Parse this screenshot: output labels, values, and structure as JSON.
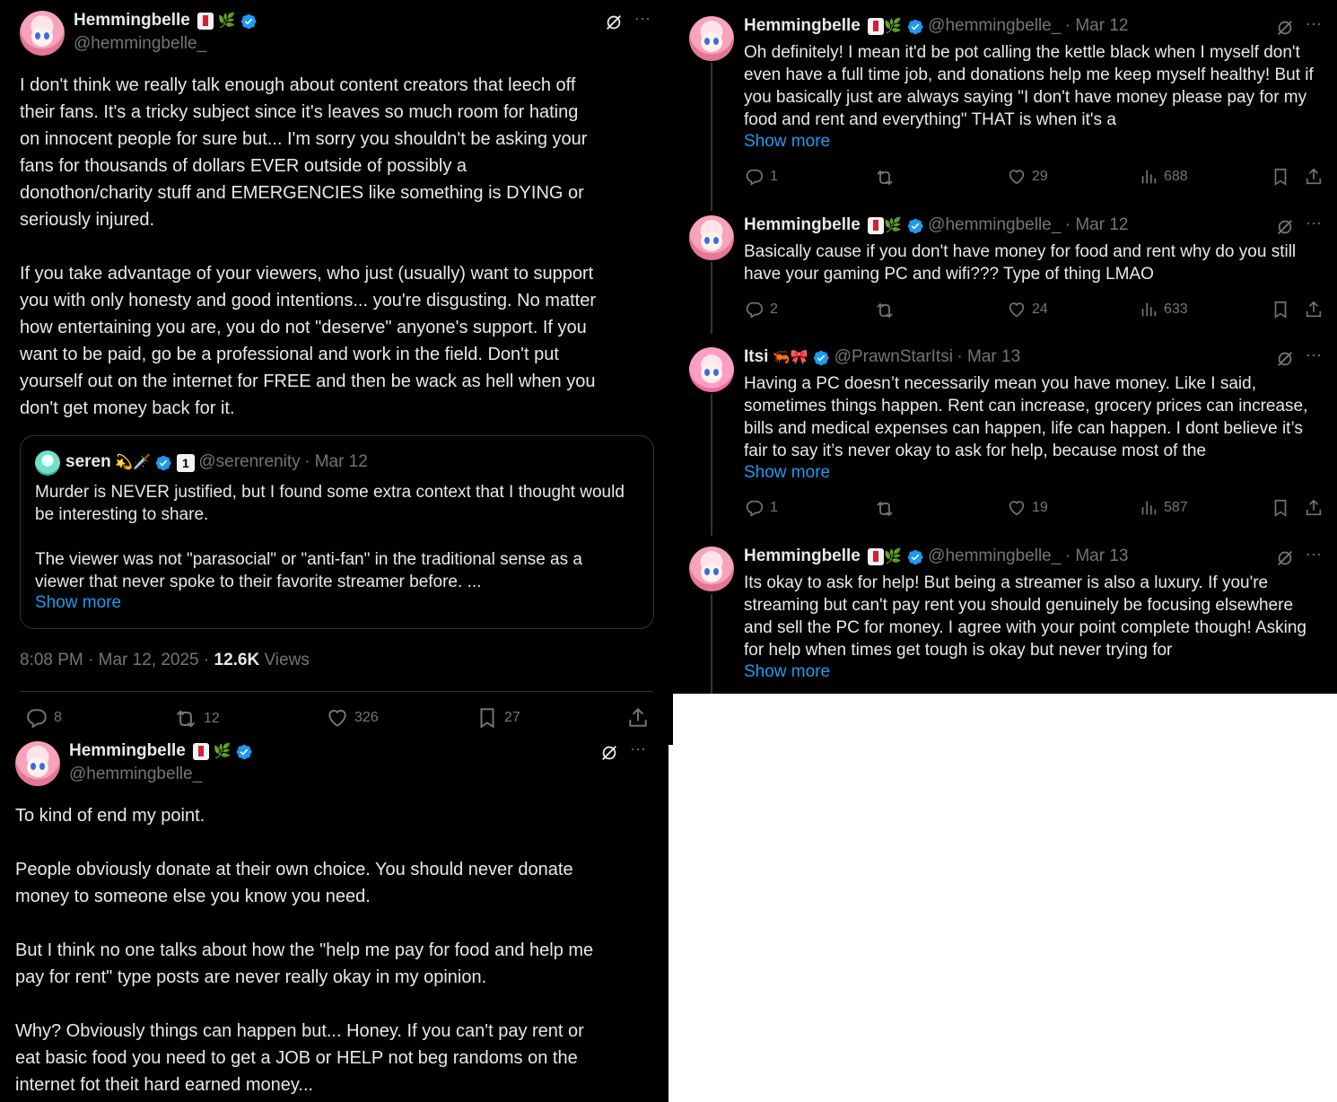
{
  "main_post": {
    "display_name": "Hemmingbelle",
    "handle": "@hemmingbelle_",
    "body": "I don't think we really talk enough about content creators that leech off\ntheir fans. It's a tricky subject since it's leaves so much room for hating\non innocent people for sure but... I'm sorry you shouldn't be asking your\nfans for thousands of dollars EVER outside of possibly a\ndonothon/charity stuff and EMERGENCIES like something is DYING or\nseriously injured.\n\nIf you take advantage of your viewers, who just (usually) want to support\nyou with only honesty and good intentions... you're disgusting. No matter\nhow entertaining you are, you do not \"deserve\" anyone's support. If you\nwant to be paid, go be a professional and work in the field. Don't put\nyourself out on the internet for FREE and then be wack as hell when you\ndon't get money back for it.",
    "quote": {
      "display_name": "seren",
      "handle": "@serenrenity",
      "date": "Mar 12",
      "text": "Murder is NEVER justified, but I found some extra context that I thought would\nbe interesting to share.\n\nThe viewer was not \"parasocial\" or \"anti-fan\" in the traditional sense as a\nviewer that never spoke to their favorite streamer before. ...",
      "show_more": "Show more"
    },
    "timestamp": "8:08 PM · Mar 12, 2025 · ",
    "views_count": "12.6K",
    "views_label": " Views",
    "stats": {
      "replies": "8",
      "reposts": "12",
      "likes": "326",
      "bookmarks": "27"
    }
  },
  "replies": [
    {
      "display_name": "Hemmingbelle",
      "handle": "@hemmingbelle_",
      "date": "· Mar 12",
      "text": "Oh definitely! I mean it'd be pot calling the kettle black when I myself don't\neven have a full time job, and donations help me keep myself healthy! But if\nyou basically just are always saying \"I don't have money please pay for my\nfood and rent and everything\" THAT is when it's a",
      "show_more": "Show more",
      "stats": {
        "replies": "1",
        "reposts": "",
        "likes": "29",
        "views": "688"
      }
    },
    {
      "display_name": "Hemmingbelle",
      "handle": "@hemmingbelle_",
      "date": "· Mar 12",
      "text": "Basically cause if you don't have money for food and rent why do you still\nhave your gaming PC and wifi??? Type of thing LMAO",
      "show_more": "",
      "stats": {
        "replies": "2",
        "reposts": "",
        "likes": "24",
        "views": "633"
      }
    },
    {
      "display_name": "Itsi",
      "handle": "@PrawnStarItsi",
      "date": "· Mar 13",
      "text": "Having a PC doesn’t necessarily mean you have money. Like I said,\nsometimes things happen. Rent can increase, grocery prices can increase,\nbills and medical expenses can happen, life can happen. I dont believe it’s\nfair to say it’s never okay to ask for help, because most of the",
      "show_more": "Show more",
      "stats": {
        "replies": "1",
        "reposts": "",
        "likes": "19",
        "views": "587"
      }
    },
    {
      "display_name": "Hemmingbelle",
      "handle": "@hemmingbelle_",
      "date": "· Mar 13",
      "text": "Its okay to ask for help! But being a streamer is also a luxury. If you're\nstreaming but can't pay rent you should genuinely be focusing elsewhere\nand sell the PC for money. I agree with your point complete though! Asking\nfor help when times get tough is okay but never trying for",
      "show_more": "Show more"
    }
  ],
  "followup_post": {
    "display_name": "Hemmingbelle",
    "handle": "@hemmingbelle_",
    "body": "To kind of end my point.\n\nPeople obviously donate at their own choice. You should never donate\nmoney to someone else you know you need.\n\nBut I think no one talks about how the \"help me pay for food and help me\npay for rent\" type posts are never really okay in my opinion.\n\nWhy? Obviously things can happen but... Honey. If you can't pay rent or\neat basic food you need to get a JOB or HELP not beg randoms on the\ninternet fot theit hard earned money..."
  },
  "icons": {
    "more": "more-icon",
    "grok": "grok-icon",
    "verified": "verified-badge-icon",
    "reply": "reply-icon",
    "repost": "repost-icon",
    "like": "like-icon",
    "views": "views-icon",
    "bookmark": "bookmark-icon",
    "share": "share-icon"
  },
  "colors": {
    "background": "#000000",
    "text": "#e7e9ea",
    "muted": "#71767b",
    "link": "#1d9bf0",
    "border": "#2f3336"
  }
}
